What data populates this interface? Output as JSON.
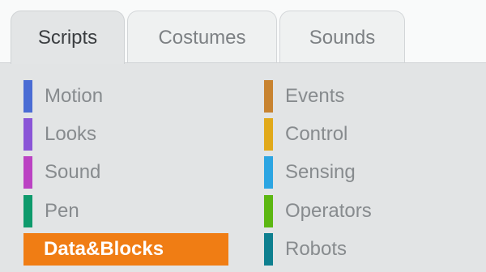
{
  "tabs": [
    {
      "label": "Scripts",
      "active": true
    },
    {
      "label": "Costumes",
      "active": false
    },
    {
      "label": "Sounds",
      "active": false
    }
  ],
  "categories": {
    "left": [
      {
        "label": "Motion",
        "color": "#4a6cd4"
      },
      {
        "label": "Looks",
        "color": "#8a55d7"
      },
      {
        "label": "Sound",
        "color": "#bb42c3"
      },
      {
        "label": "Pen",
        "color": "#0e9a6c"
      },
      {
        "label": "Data&Blocks",
        "color": "#f07d14",
        "selected": true
      }
    ],
    "right": [
      {
        "label": "Events",
        "color": "#c88330"
      },
      {
        "label": "Control",
        "color": "#e1a91a"
      },
      {
        "label": "Sensing",
        "color": "#2ca5e2"
      },
      {
        "label": "Operators",
        "color": "#5cb712"
      },
      {
        "label": "Robots",
        "color": "#0e7f8f"
      }
    ]
  },
  "colors": {
    "accent": "#f07d14",
    "panel_bg": "#e2e4e5"
  }
}
